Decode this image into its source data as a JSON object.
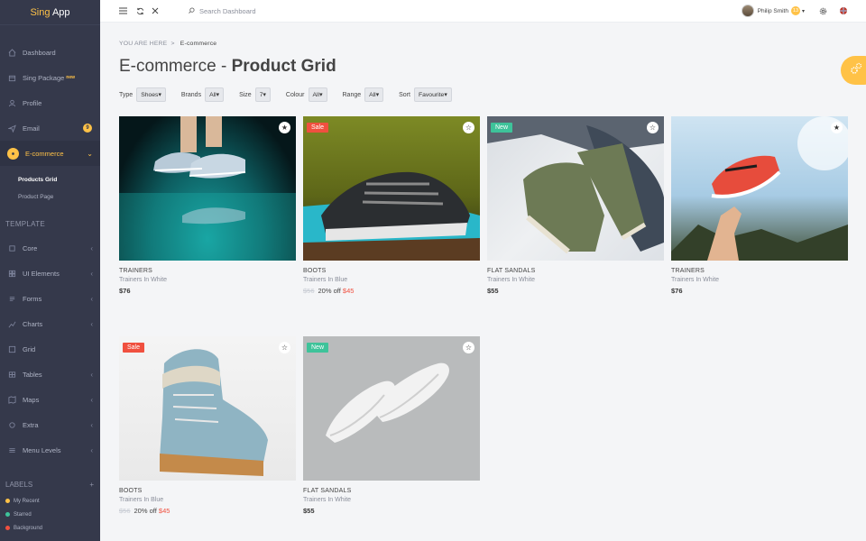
{
  "app": {
    "name_part1": "Sing",
    "name_part2": "App"
  },
  "sidebar": {
    "items": [
      {
        "label": "Dashboard",
        "icon": "home-icon"
      },
      {
        "label": "Sing Package",
        "badge": "new",
        "icon": "package-icon"
      },
      {
        "label": "Profile",
        "icon": "user-icon"
      },
      {
        "label": "Email",
        "count": "9",
        "icon": "mail-icon"
      },
      {
        "label": "E-commerce",
        "icon": "cart-icon"
      }
    ],
    "subitems": [
      "Products Grid",
      "Product Page"
    ],
    "template_title": "TEMPLATE",
    "template_items": [
      "Core",
      "UI Elements",
      "Forms",
      "Charts",
      "Grid",
      "Tables",
      "Maps",
      "Extra",
      "Menu Levels"
    ],
    "labels_title": "LABELS",
    "labels": [
      {
        "label": "My Recent",
        "color": "#ffc247"
      },
      {
        "label": "Starred",
        "color": "#3ec39a"
      },
      {
        "label": "Background",
        "color": "#f0503f"
      }
    ]
  },
  "topbar": {
    "search_placeholder": "Search Dashboard",
    "user_name": "Philip Smith",
    "user_count": "13"
  },
  "breadcrumb": {
    "prefix": "YOU ARE HERE",
    "sep": ">",
    "current": "E-commerce"
  },
  "page": {
    "title_light": "E-commerce - ",
    "title_bold": "Product Grid"
  },
  "filters": [
    {
      "label": "Type",
      "value": "Shoes"
    },
    {
      "label": "Brands",
      "value": "All"
    },
    {
      "label": "Size",
      "value": "7"
    },
    {
      "label": "Colour",
      "value": "All"
    },
    {
      "label": "Range",
      "value": "All"
    },
    {
      "label": "Sort",
      "value": "Favourite"
    }
  ],
  "products": [
    {
      "tag": "",
      "category": "TRAINERS",
      "name": "Trainers In White",
      "price": "$76",
      "old_price": "",
      "discount": "",
      "starred": true
    },
    {
      "tag": "Sale",
      "category": "BOOTS",
      "name": "Trainers In Blue",
      "price": "$45",
      "old_price": "$56",
      "discount": "20% off",
      "starred": false
    },
    {
      "tag": "New",
      "category": "FLAT SANDALS",
      "name": "Trainers In White",
      "price": "$55",
      "old_price": "",
      "discount": "",
      "starred": false
    },
    {
      "tag": "",
      "category": "TRAINERS",
      "name": "Trainers In White",
      "price": "$76",
      "old_price": "",
      "discount": "",
      "starred": true
    },
    {
      "tag": "Sale",
      "category": "BOOTS",
      "name": "Trainers In Blue",
      "price": "$45",
      "old_price": "$56",
      "discount": "20% off",
      "starred": false
    },
    {
      "tag": "New",
      "category": "FLAT SANDALS",
      "name": "Trainers In White",
      "price": "$55",
      "old_price": "",
      "discount": "",
      "starred": false
    }
  ],
  "colors": {
    "accent": "#ffc247",
    "sidebar": "#35394b",
    "sale": "#f0503f",
    "new": "#3ec39a"
  }
}
